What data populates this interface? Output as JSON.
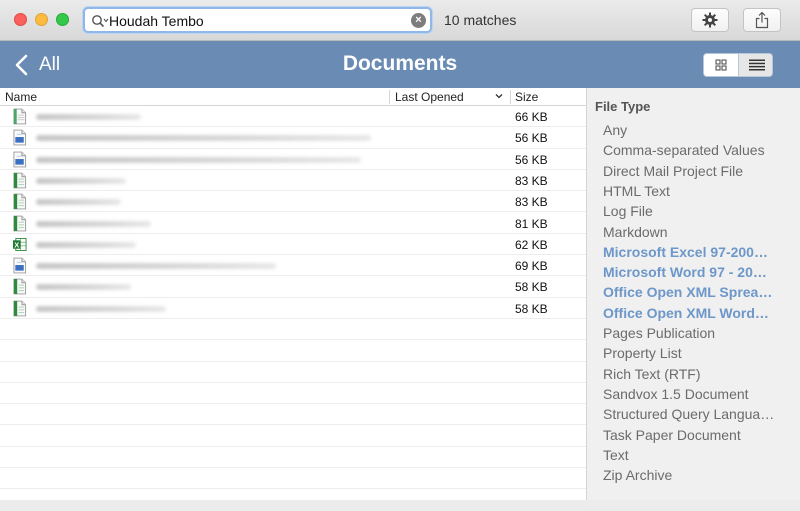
{
  "window": {
    "search": {
      "value": "Houdah Tembo"
    },
    "matches": "10 matches",
    "icons": {
      "gear": "gear-icon",
      "share": "share-icon",
      "clear": "clear-icon",
      "search": "magnifier-icon"
    }
  },
  "nav": {
    "back_label": "All",
    "title": "Documents",
    "view_modes": [
      "grid-view-icon",
      "list-view-icon"
    ],
    "active_view": "list"
  },
  "table": {
    "columns": {
      "name": "Name",
      "last_opened": "Last Opened",
      "size": "Size"
    },
    "rows": [
      {
        "icon": "text-doc-icon",
        "size": "66 KB"
      },
      {
        "icon": "word-doc-icon",
        "size": "56 KB"
      },
      {
        "icon": "word-doc-icon",
        "size": "56 KB"
      },
      {
        "icon": "excel-doc-icon",
        "size": "83 KB"
      },
      {
        "icon": "excel-doc-icon",
        "size": "83 KB"
      },
      {
        "icon": "excel-doc-icon",
        "size": "81 KB"
      },
      {
        "icon": "excel-x-icon",
        "size": "62 KB"
      },
      {
        "icon": "word-doc-icon",
        "size": "69 KB"
      },
      {
        "icon": "excel-doc-icon",
        "size": "58 KB"
      },
      {
        "icon": "excel-doc-icon",
        "size": "58 KB"
      }
    ]
  },
  "sidebar": {
    "heading": "File Type",
    "items": [
      {
        "label": "Any",
        "selected": false
      },
      {
        "label": "Comma-separated Values",
        "selected": false
      },
      {
        "label": "Direct Mail Project File",
        "selected": false
      },
      {
        "label": "HTML Text",
        "selected": false
      },
      {
        "label": "Log File",
        "selected": false
      },
      {
        "label": "Markdown",
        "selected": false
      },
      {
        "label": "Microsoft Excel 97-200…",
        "selected": true
      },
      {
        "label": "Microsoft Word 97 - 20…",
        "selected": true
      },
      {
        "label": "Office Open XML Sprea…",
        "selected": true
      },
      {
        "label": "Office Open XML Word…",
        "selected": true
      },
      {
        "label": "Pages Publication",
        "selected": false
      },
      {
        "label": "Property List",
        "selected": false
      },
      {
        "label": "Rich Text (RTF)",
        "selected": false
      },
      {
        "label": "Sandvox 1.5 Document",
        "selected": false
      },
      {
        "label": "Structured Query Langua…",
        "selected": false
      },
      {
        "label": "Task Paper Document",
        "selected": false
      },
      {
        "label": "Text",
        "selected": false
      },
      {
        "label": "Zip Archive",
        "selected": false
      }
    ]
  },
  "colors": {
    "nav_bar": "#6a8cb4",
    "selected_type": "#6d97c9",
    "excel_green": "#2e8b3d",
    "word_blue": "#3b6fc1"
  }
}
